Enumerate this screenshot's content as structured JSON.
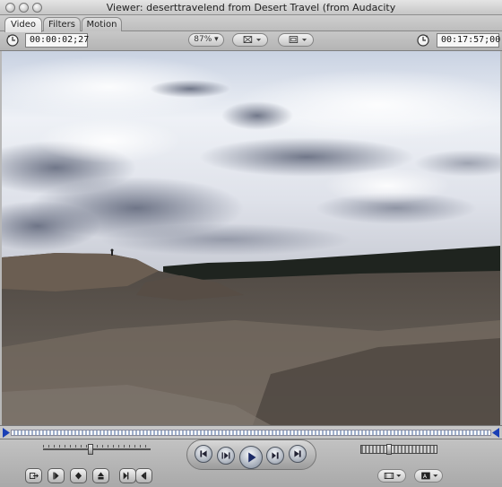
{
  "window": {
    "title": "Viewer: deserttravelend from Desert Travel (from Audacity"
  },
  "tabs": [
    {
      "label": "Video",
      "active": true
    },
    {
      "label": "Filters",
      "active": false
    },
    {
      "label": "Motion",
      "active": false
    }
  ],
  "toolbar": {
    "clip_duration": "00:00:02;27",
    "zoom": "87%",
    "current_timecode": "00:17:57;00"
  },
  "colors": {
    "playhead": "#1a3fb5",
    "scrub_track": "#9fb0cc"
  },
  "transport": {
    "buttons": [
      "previous-edit",
      "play-in-to-out",
      "play",
      "play-around-current",
      "next-edit"
    ],
    "shuttle_level": 0.36
  },
  "bottom_buttons": [
    "insert-edit",
    "mark-in",
    "add-marker",
    "add-keyframe",
    "mark-in-out",
    "view-options",
    "overlay-options"
  ]
}
